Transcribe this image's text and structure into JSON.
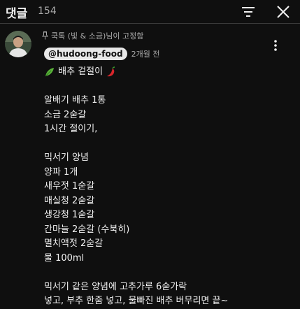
{
  "header": {
    "title": "댓글",
    "count": "154"
  },
  "comment": {
    "pinned_text": "쿡톡 (빛 & 소금)님이 고정함",
    "author": "@hudoong-food",
    "timestamp": "2개월 전",
    "title_text": "배추 겉절이",
    "lines": [
      "",
      "알배기 배추 1통",
      "소금 2숟갈",
      "1시간 절이기,",
      "",
      "믹서기 양념",
      "양파 1개",
      "새우젓 1숟갈",
      "매실청 2숟갈",
      "생강청 1숟갈",
      "간마늘 2숟갈 (수북히)",
      "멸치액젓 2숟갈",
      "물 100ml",
      "",
      "믹서기 같은 양념에 고추가루 6숟가락",
      "넣고, 부추 한줌 넣고, 물빠진 배추 버무리면 끝~"
    ]
  },
  "icons": {
    "sort": "sort-icon",
    "close": "close-icon",
    "pin": "pin-icon",
    "more": "more-vert-icon",
    "herb": "herb-emoji",
    "pepper": "hot-pepper-emoji"
  },
  "colors": {
    "background": "#0f0f0f",
    "text": "#f1f1f1",
    "secondary_text": "#aaaaaa",
    "badge_bg": "#e8e8e8"
  }
}
